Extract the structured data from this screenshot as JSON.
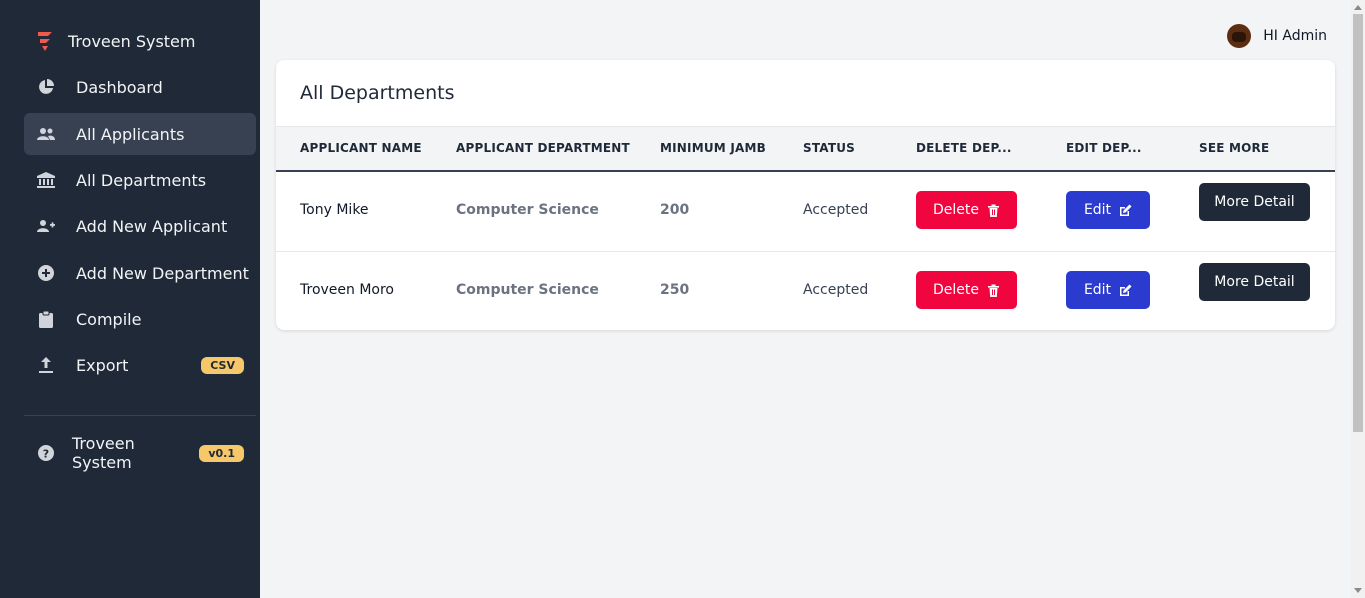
{
  "sidebar": {
    "brand": "Troveen System",
    "items": [
      {
        "label": "Dashboard",
        "icon": "chart-pie-icon"
      },
      {
        "label": "All Applicants",
        "icon": "users-icon"
      },
      {
        "label": "All Departments",
        "icon": "bank-icon"
      },
      {
        "label": "Add New Applicant",
        "icon": "user-add-icon"
      },
      {
        "label": "Add New Department",
        "icon": "plus-circle-icon"
      },
      {
        "label": "Compile",
        "icon": "clipboard-icon"
      },
      {
        "label": "Export",
        "icon": "upload-icon",
        "badge": "CSV"
      }
    ],
    "footer": {
      "label": "Troveen System",
      "badge": "v0.1",
      "icon": "question-circle-icon"
    }
  },
  "header": {
    "greeting": "HI Admin"
  },
  "card": {
    "title": "All Departments",
    "columns": [
      "APPLICANT NAME",
      "APPLICANT DEPARTMENT",
      "MINIMUM JAMB",
      "STATUS",
      "DELETE DEP...",
      "EDIT DEP...",
      "SEE MORE"
    ],
    "rows": [
      {
        "name": "Tony Mike",
        "department": "Computer Science",
        "jamb": "200",
        "status": "Accepted",
        "delete": "Delete",
        "edit": "Edit",
        "more": "More Detail"
      },
      {
        "name": "Troveen Moro",
        "department": "Computer Science",
        "jamb": "250",
        "status": "Accepted",
        "delete": "Delete",
        "edit": "Edit",
        "more": "More Detail"
      }
    ]
  },
  "colors": {
    "sidebar": "#1f2937",
    "delete": "#f0053f",
    "edit": "#2b3bd0",
    "more": "#1f2937",
    "badge": "#f6c86a",
    "brand_accent": "#f05a4a"
  }
}
